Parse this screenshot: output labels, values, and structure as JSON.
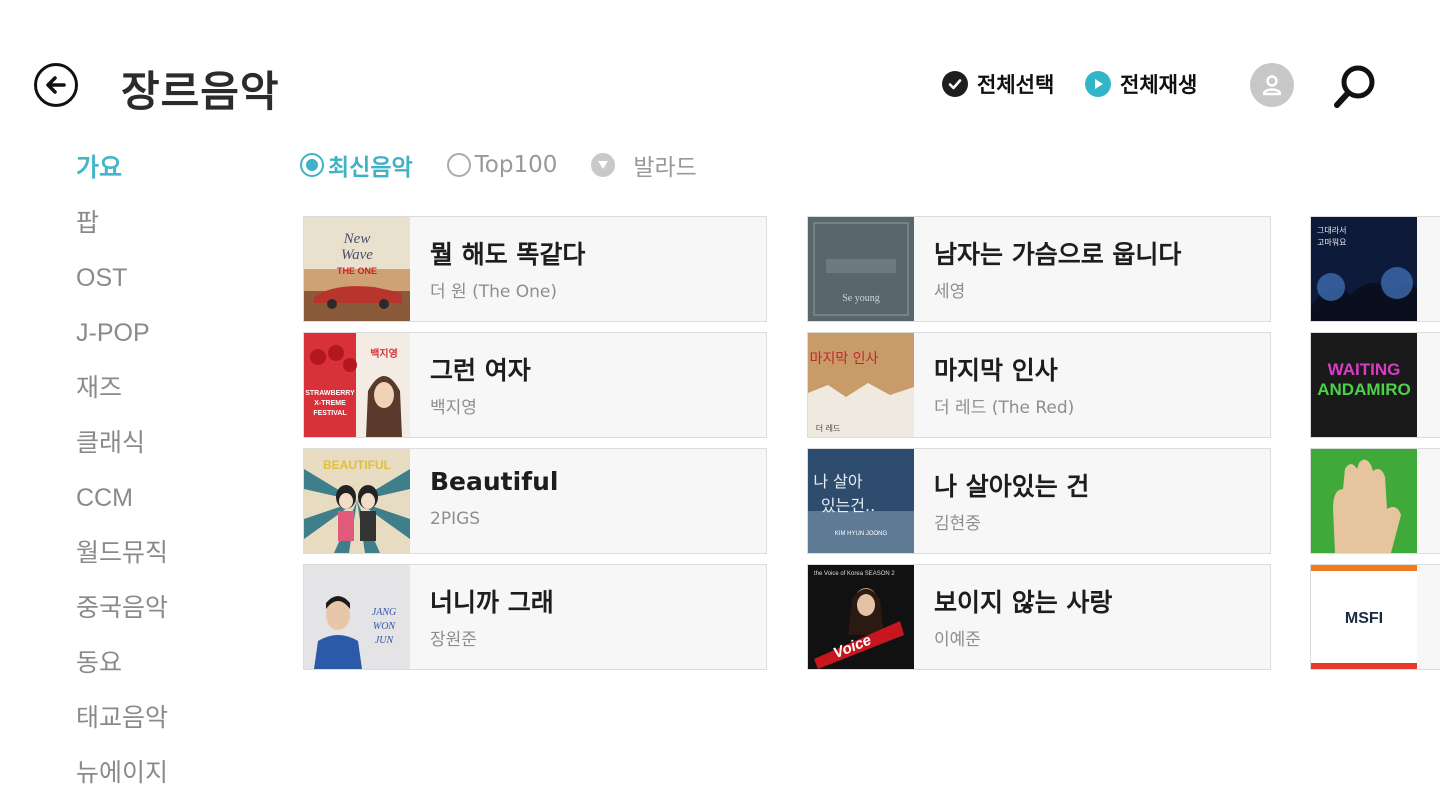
{
  "header": {
    "title": "장르음악",
    "select_all": "전체선택",
    "play_all": "전체재생"
  },
  "sidebar": {
    "items": [
      {
        "label": "가요",
        "active": true
      },
      {
        "label": "팝",
        "active": false
      },
      {
        "label": "OST",
        "active": false
      },
      {
        "label": "J-POP",
        "active": false
      },
      {
        "label": "재즈",
        "active": false
      },
      {
        "label": "클래식",
        "active": false
      },
      {
        "label": "CCM",
        "active": false
      },
      {
        "label": "월드뮤직",
        "active": false
      },
      {
        "label": "중국음악",
        "active": false
      },
      {
        "label": "동요",
        "active": false
      },
      {
        "label": "태교음악",
        "active": false
      },
      {
        "label": "뉴에이지",
        "active": false
      }
    ]
  },
  "filters": {
    "latest": "최신음악",
    "top100": "Top100",
    "genre_dropdown": "발라드"
  },
  "songs": [
    {
      "title": "뭘 해도 똑같다",
      "artist": "더 원 (The One)",
      "art_text": "New Wave · THE ONE"
    },
    {
      "title": "그런 여자",
      "artist": "백지영",
      "art_text": "STRAWBERRY X-TREME FESTIVAL · 백지영"
    },
    {
      "title": "Beautiful",
      "artist": "2PIGS",
      "art_text": "BEAUTIFUL"
    },
    {
      "title": "너니까 그래",
      "artist": "장원준",
      "art_text": "JANG WON JUN"
    },
    {
      "title": "남자는 가슴으로 웁니다",
      "artist": "세영",
      "art_text": "Se young"
    },
    {
      "title": "마지막 인사",
      "artist": "더 레드 (The Red)",
      "art_text": "마지막 인사 · 더 레드"
    },
    {
      "title": "나 살아있는 건",
      "artist": "김현중",
      "art_text": "나 살아 있는 건.."
    },
    {
      "title": "보이지 않는 사랑",
      "artist": "이예준",
      "art_text": "The Voice of Korea SEASON 2"
    }
  ],
  "partial_cards": [
    {
      "art_text": "그대라서 고마워요"
    },
    {
      "art_text": "WAITING ANDAMIRO"
    },
    {
      "art_text": ""
    },
    {
      "art_text": "MSFI"
    }
  ],
  "colors": {
    "accent": "#44b6c8",
    "text_dark": "#222222",
    "text_muted": "#8a8a8a",
    "card_bg": "#f7f7f7",
    "avatar_bg": "#c7c7c7"
  },
  "icons": {
    "back": "arrow-left-circle",
    "select_all": "check-circle",
    "play_all": "play-circle",
    "profile": "user-circle",
    "search": "magnifier",
    "dropdown": "caret-down-circle"
  }
}
